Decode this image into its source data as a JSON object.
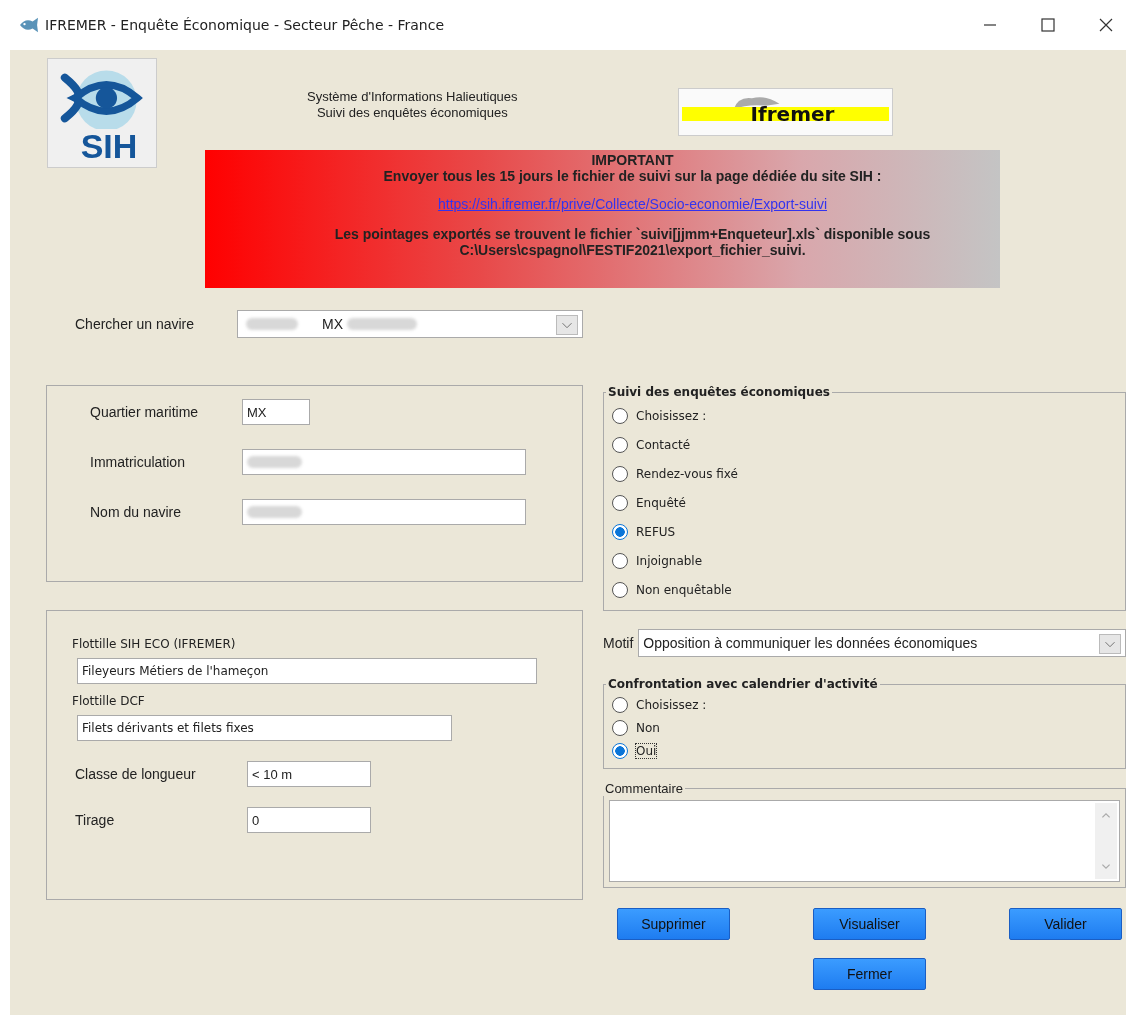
{
  "window": {
    "title": "IFREMER - Enquête Économique - Secteur Pêche - France"
  },
  "header": {
    "sih_logo_text": "SIH",
    "subtitle_lines": [
      "Système d'Informations Halieutiques",
      "Suivi des enquêtes économiques"
    ],
    "ifremer_logo_text": "Ifremer"
  },
  "banner": {
    "heading": "IMPORTANT",
    "line": "Envoyer tous les 15 jours le fichier de suivi sur la page dédiée du site SIH :",
    "link": " https://sih.ifremer.fr/prive/Collecte/Socio-economie/Export-suivi",
    "note_lines": [
      "Les pointages exportés se trouvent le fichier `suivi[jjmm+Enqueteur].xls` disponible sous",
      "C:\\Users\\cspagnol\\FESTIF2021\\export_fichier_suivi."
    ]
  },
  "search": {
    "label": "Chercher un navire",
    "value": "MX",
    "redacted": true
  },
  "vessel": {
    "fields": [
      {
        "label": "Quartier maritime",
        "value": "MX",
        "redacted": false,
        "kind": "short"
      },
      {
        "label": "Immatriculation",
        "redacted": true,
        "kind": "long"
      },
      {
        "label": "Nom du navire",
        "redacted": true,
        "kind": "long"
      }
    ]
  },
  "fleet": {
    "fields": [
      {
        "label": "Flottille SIH ECO (IFREMER)",
        "value": "Fileyeurs Métiers de l'hameçon",
        "kind": "stacked"
      },
      {
        "label": "Flottille DCF",
        "value": "Filets dérivants et filets fixes",
        "kind": "stacked"
      },
      {
        "label": "Classe de longueur",
        "value": "< 10 m",
        "kind": "inline"
      },
      {
        "label": "Tirage",
        "value": "0",
        "kind": "inline"
      }
    ]
  },
  "survey_status": {
    "title": "Suivi des enquêtes économiques",
    "options": [
      {
        "label": "Choisissez :",
        "selected": false
      },
      {
        "label": "Contacté",
        "selected": false
      },
      {
        "label": "Rendez-vous fixé",
        "selected": false
      },
      {
        "label": "Enquêté",
        "selected": false
      },
      {
        "label": "REFUS",
        "selected": true
      },
      {
        "label": "Injoignable",
        "selected": false
      },
      {
        "label": "Non enquêtable",
        "selected": false
      }
    ]
  },
  "motif": {
    "label": "Motif",
    "value": "Opposition à communiquer les données économiques"
  },
  "confrontation": {
    "title": "Confrontation avec calendrier d'activité",
    "options": [
      {
        "label": "Choisissez :",
        "selected": false
      },
      {
        "label": "Non",
        "selected": false
      },
      {
        "label": "Oui",
        "selected": true
      }
    ]
  },
  "comment": {
    "title": "Commentaire"
  },
  "buttons": [
    "Supprimer",
    "Visualiser",
    "Valider",
    "Fermer"
  ]
}
